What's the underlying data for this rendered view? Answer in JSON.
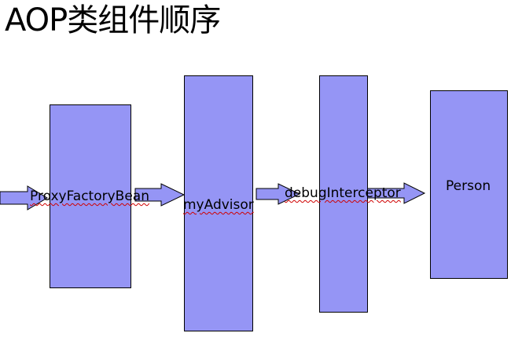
{
  "slide": {
    "title": "AOP类组件顺序",
    "fill_color": "#9595f5",
    "border_color": "#000000",
    "spellcheck_underline_color": "#d00000"
  },
  "components": [
    {
      "label": "ProxyFactoryBean"
    },
    {
      "label": "myAdvisor"
    },
    {
      "label": "debugInterceptor"
    },
    {
      "label": "Person"
    }
  ]
}
